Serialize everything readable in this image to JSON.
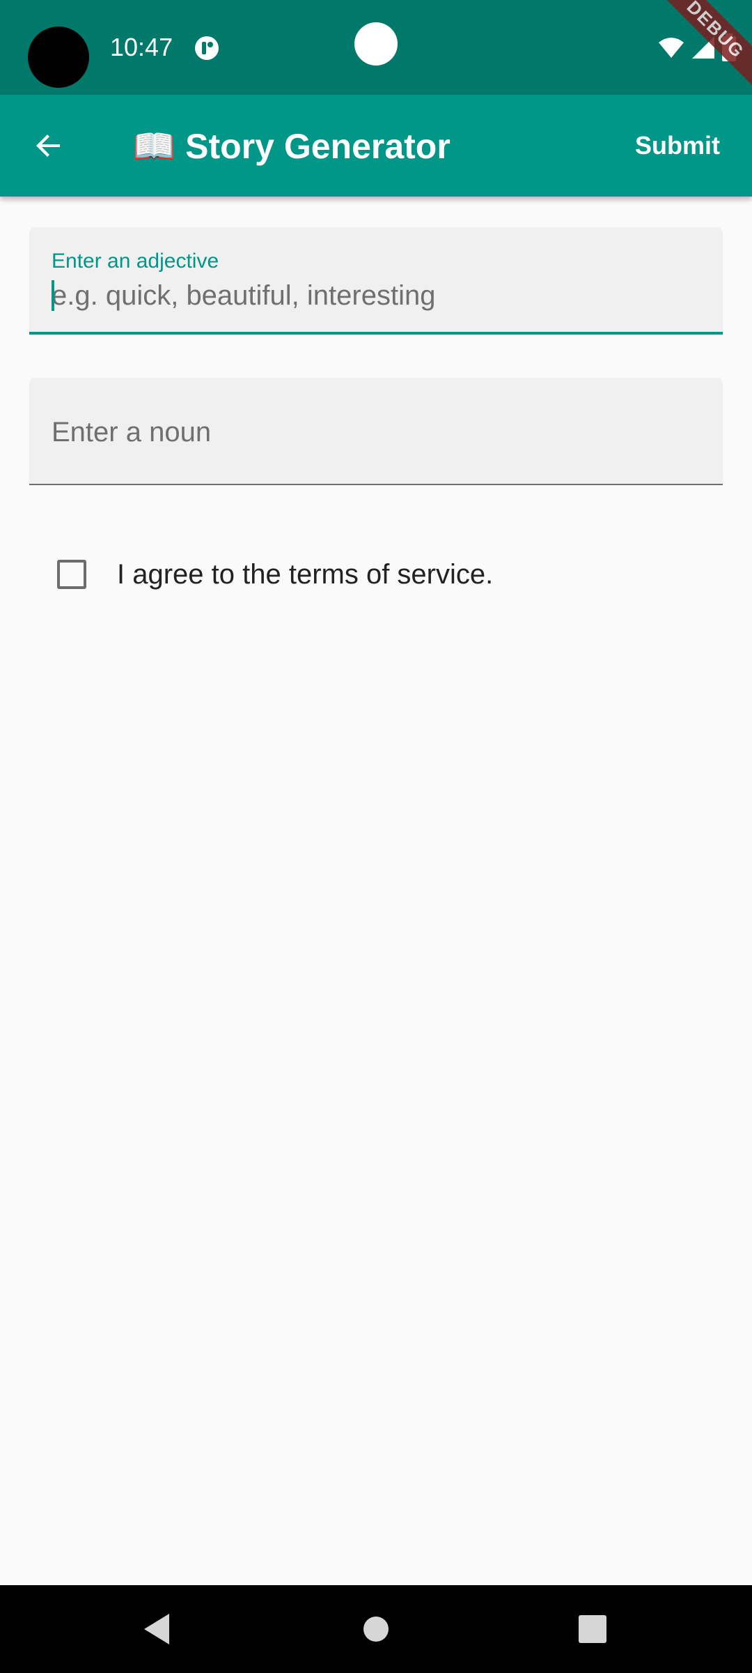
{
  "status_bar": {
    "time": "10:47",
    "debug_badge": "DEBUG"
  },
  "app_bar": {
    "title": "📖 Story Generator",
    "submit_label": "Submit",
    "background": "#009688"
  },
  "form": {
    "adjective": {
      "label": "Enter an adjective",
      "placeholder": "e.g. quick, beautiful, interesting",
      "value": "",
      "focused": true
    },
    "noun": {
      "label": "Enter a noun",
      "value": ""
    },
    "terms": {
      "label": "I agree to the terms of service.",
      "checked": false
    }
  },
  "colors": {
    "status_bar": "#00796b",
    "accent": "#009688",
    "background": "#fafafa"
  },
  "icons": {
    "back": "arrow-back-icon",
    "wifi": "wifi-icon",
    "signal": "signal-icon",
    "battery": "battery-icon",
    "nav_back": "nav-back-icon",
    "nav_home": "nav-home-icon",
    "nav_recents": "nav-recents-icon"
  }
}
